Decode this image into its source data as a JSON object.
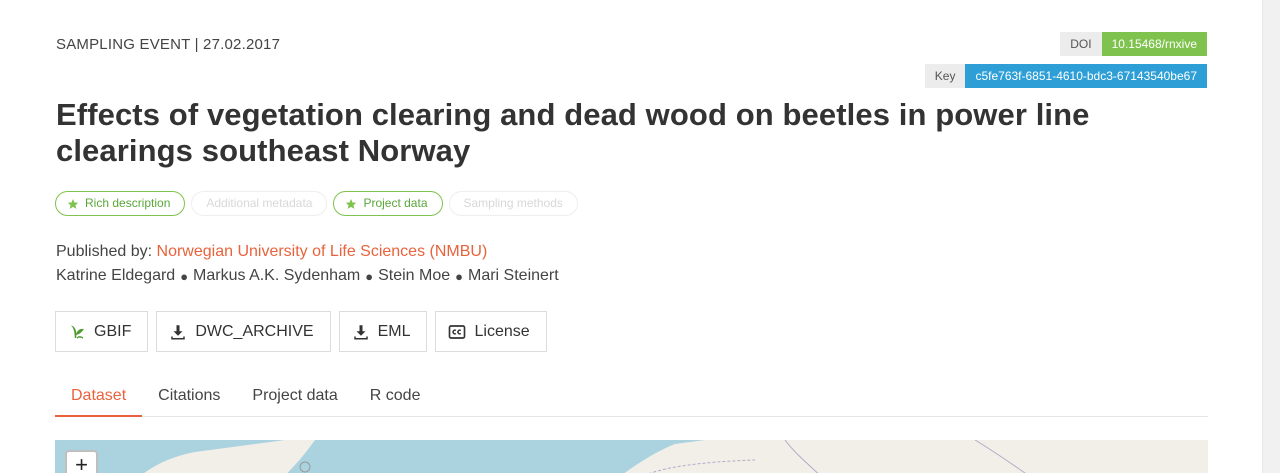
{
  "header": {
    "event_type": "SAMPLING EVENT",
    "separator": "|",
    "date": "27.02.2017",
    "event_line": "SAMPLING EVENT | 27.02.2017"
  },
  "identifiers": {
    "doi_label": "DOI",
    "doi_value": "10.15468/rnxive",
    "key_label": "Key",
    "key_value": "c5fe763f-6851-4610-bdc3-67143540be67"
  },
  "title": "Effects of vegetation clearing and dead wood on beetles in power line clearings southeast Norway",
  "pills": [
    {
      "label": "Rich description",
      "active": true
    },
    {
      "label": "Additional metadata",
      "active": false
    },
    {
      "label": "Project data",
      "active": true
    },
    {
      "label": "Sampling methods",
      "active": false
    }
  ],
  "published": {
    "prefix": "Published by:",
    "publisher": "Norwegian University of Life Sciences (NMBU)"
  },
  "authors": [
    "Katrine Eldegard",
    "Markus A.K. Sydenham",
    "Stein Moe",
    "Mari Steinert"
  ],
  "author_separator": "●",
  "buttons": [
    {
      "label": "GBIF",
      "icon": "gbif-icon"
    },
    {
      "label": "DWC_ARCHIVE",
      "icon": "download-icon"
    },
    {
      "label": "EML",
      "icon": "download-icon"
    },
    {
      "label": "License",
      "icon": "cc-icon"
    }
  ],
  "tabs": [
    {
      "label": "Dataset",
      "active": true
    },
    {
      "label": "Citations",
      "active": false
    },
    {
      "label": "Project data",
      "active": false
    },
    {
      "label": "R code",
      "active": false
    }
  ],
  "map": {
    "zoom_in_label": "+"
  },
  "colors": {
    "accent": "#e8633c",
    "doi_badge": "#7fc34e",
    "key_badge": "#2e9fd6",
    "pill_green": "#7fc34e"
  }
}
